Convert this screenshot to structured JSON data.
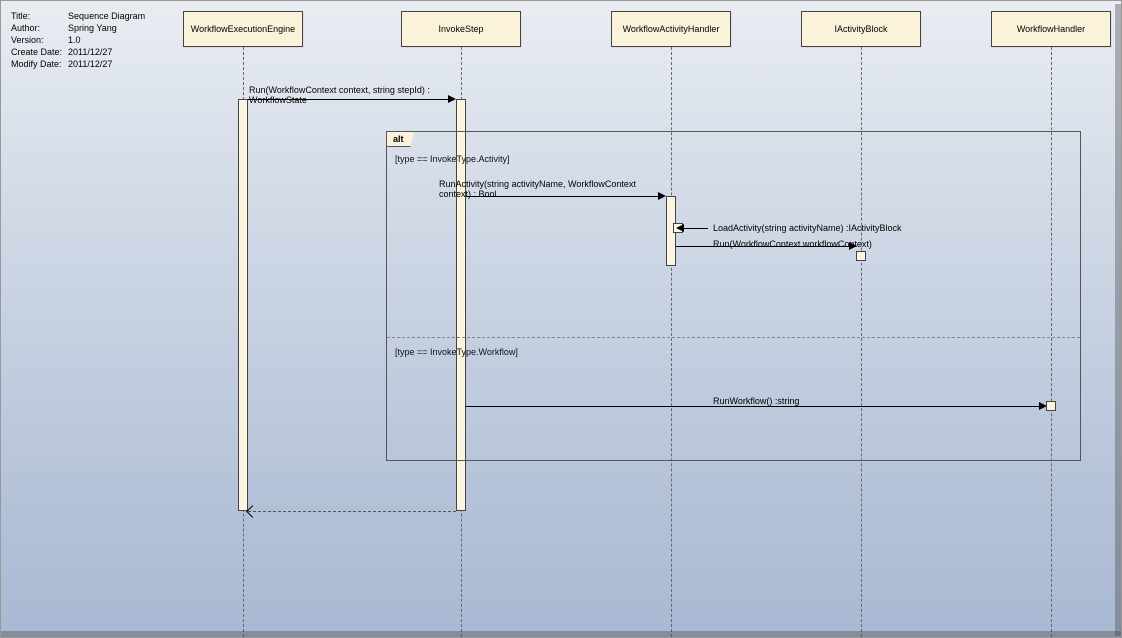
{
  "meta": {
    "title_label": "Title",
    "title_value": "Sequence Diagram",
    "author_label": "Author",
    "author_value": "Spring Yang",
    "version_label": "Version",
    "version_value": "1.0",
    "create_label": "Create Date",
    "create_value": "2011/12/27",
    "modify_label": "Modify Date",
    "modify_value": "2011/12/27"
  },
  "lifelines": {
    "l0": "WorkflowExecutionEngine",
    "l1": "InvokeStep",
    "l2": "WorkflowActivityHandler",
    "l3": "IActivityBlock",
    "l4": "WorkflowHandler"
  },
  "fragment": {
    "label": "alt",
    "guard1": "[type == InvokeType.Activity]",
    "guard2": "[type == InvokeType.Workflow]"
  },
  "messages": {
    "m1": "Run(WorkflowContext context, string stepId) : WorkflowState",
    "m2": "RunActivity(string activityName, WorkflowContext context) : Bool",
    "m3": "LoadActivity(string activityName) :IActivityBlock",
    "m4": "Run(WorkflowContext workflowContext)",
    "m5": "RunWorkflow() :string"
  }
}
